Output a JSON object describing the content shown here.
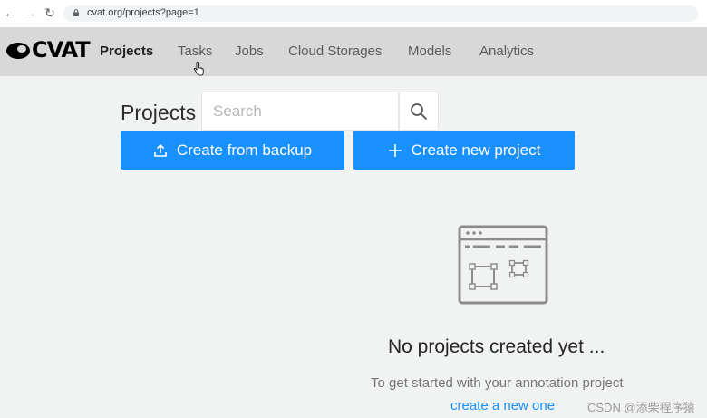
{
  "browser": {
    "url": "cvat.org/projects?page=1",
    "back_icon": "arrow-left-icon",
    "forward_icon": "arrow-right-icon",
    "reload_icon": "reload-icon"
  },
  "header": {
    "logo_text": "CVAT",
    "nav": [
      {
        "label": "Projects",
        "active": true
      },
      {
        "label": "Tasks",
        "active": false
      },
      {
        "label": "Jobs",
        "active": false
      },
      {
        "label": "Cloud Storages",
        "active": false
      },
      {
        "label": "Models",
        "active": false
      },
      {
        "label": "Analytics",
        "active": false
      }
    ]
  },
  "projects": {
    "title": "Projects",
    "search_placeholder": "Search",
    "create_from_backup_label": "Create from backup",
    "create_new_label": "Create new project"
  },
  "empty_state": {
    "title": "No projects created yet ...",
    "subtitle": "To get started with your annotation project",
    "link": "create a new one"
  },
  "watermark": "CSDN @添柴程序猿",
  "colors": {
    "primary": "#1890ff",
    "header_bg": "#d8d8d8",
    "page_bg": "#f1f2f2"
  }
}
